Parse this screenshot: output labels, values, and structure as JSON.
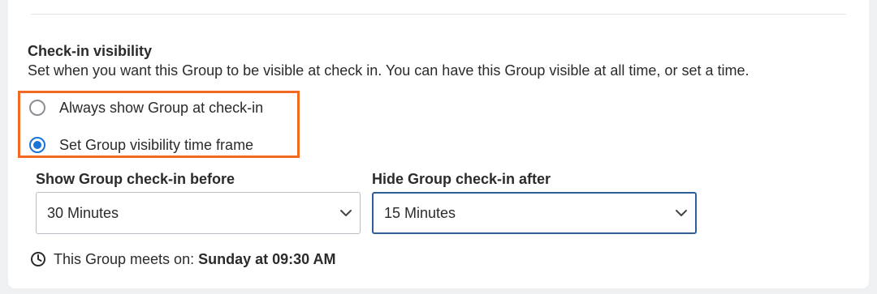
{
  "checkin_visibility": {
    "title": "Check-in visibility",
    "description": "Set when you want this Group to be visible at check in. You can have this Group visible at all time, or set a time.",
    "options": [
      {
        "label": "Always show Group at check-in",
        "selected": false
      },
      {
        "label": "Set Group visibility time frame",
        "selected": true
      }
    ],
    "highlight_color": "#f26a22",
    "accent_color": "#1a73d9"
  },
  "show_before": {
    "label": "Show Group check-in before",
    "value": "30 Minutes",
    "icon": "chevron-down-icon"
  },
  "hide_after": {
    "label": "Hide Group check-in after",
    "value": "15 Minutes",
    "icon": "chevron-down-icon",
    "focused_border_color": "#2f5f95"
  },
  "meeting_info": {
    "icon": "clock-icon",
    "prefix": "This Group meets on:",
    "value": "Sunday at 09:30 AM"
  }
}
